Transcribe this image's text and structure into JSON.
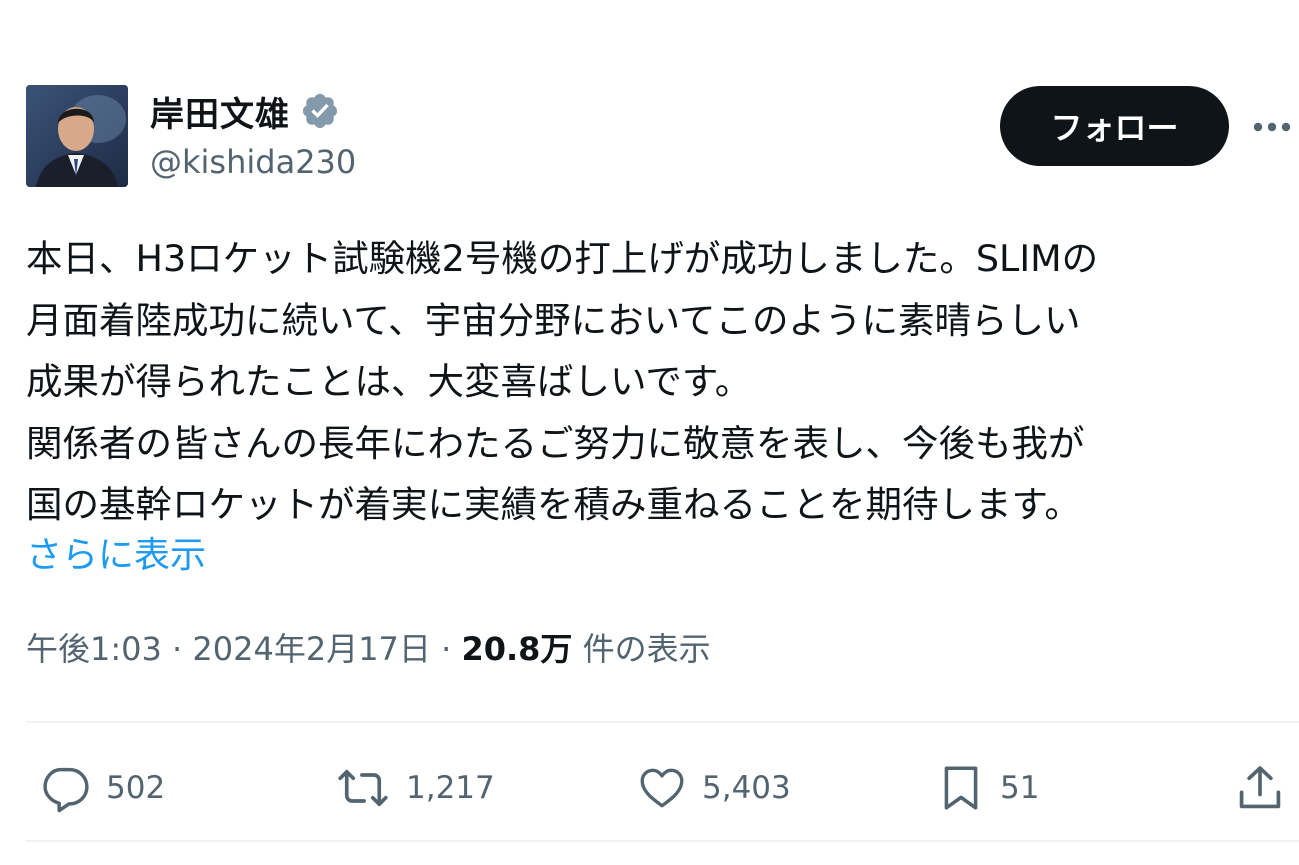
{
  "author": {
    "name": "岸田文雄",
    "handle": "@kishida230",
    "verified_color": "#829aab"
  },
  "follow_button": {
    "label": "フォロー"
  },
  "more_menu": {
    "icon": "more-horizontal-icon"
  },
  "tweet": {
    "text": "本日、H3ロケット試験機2号機の打上げが成功しました。SLIMの\n月面着陸成功に続いて、宇宙分野においてこのように素晴らしい\n成果が得られたことは、大変喜ばしいです。\n関係者の皆さんの長年にわたるご努力に敬意を表し、今後も我が\n国の基幹ロケットが着実に実績を積み重ねることを期待します。",
    "show_more": "さらに表示"
  },
  "meta": {
    "time": "午後1:03",
    "sep1": " · ",
    "date": "2024年2月17日",
    "sep2": " · ",
    "views_count": "20.8万",
    "views_label": " 件の表示"
  },
  "actions": {
    "reply": {
      "icon": "reply-icon",
      "count": "502"
    },
    "retweet": {
      "icon": "retweet-icon",
      "count": "1,217"
    },
    "like": {
      "icon": "heart-icon",
      "count": "5,403"
    },
    "bookmark": {
      "icon": "bookmark-icon",
      "count": "51"
    },
    "share": {
      "icon": "share-icon"
    }
  },
  "colors": {
    "text": "#0f1419",
    "secondary": "#536471",
    "link": "#1d9bf0",
    "follow_bg": "#0f1419"
  }
}
